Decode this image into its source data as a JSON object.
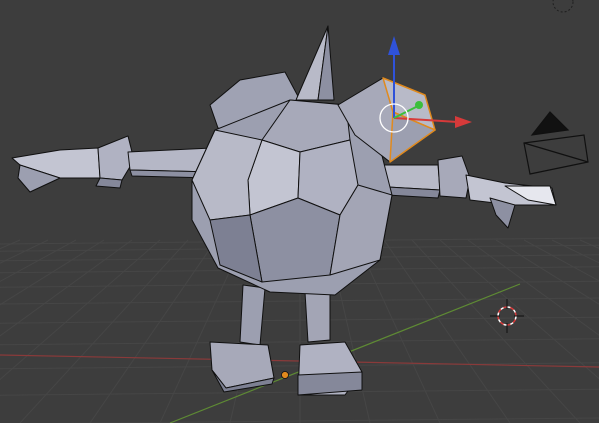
{
  "viewport": {
    "background": "#3d3d3d",
    "grid_color": "#464646",
    "x_axis_color": "#8a3a3a",
    "y_axis_color": "#5e8a34"
  },
  "model": {
    "body_color": "#9c9fb0",
    "highlight_color": "#c3c5d2",
    "shadow_color": "#75788a",
    "edge_color": "#101010",
    "selected_color": "#e08a1e"
  },
  "gizmo": {
    "x_axis_color": "#d63a3a",
    "y_axis_color": "#3cbf3c",
    "z_axis_color": "#2f52d9",
    "center_color": "#ffffff"
  },
  "icons": {
    "camera": "camera-icon",
    "cursor": "3d-cursor-icon",
    "origin": "object-origin-icon"
  }
}
